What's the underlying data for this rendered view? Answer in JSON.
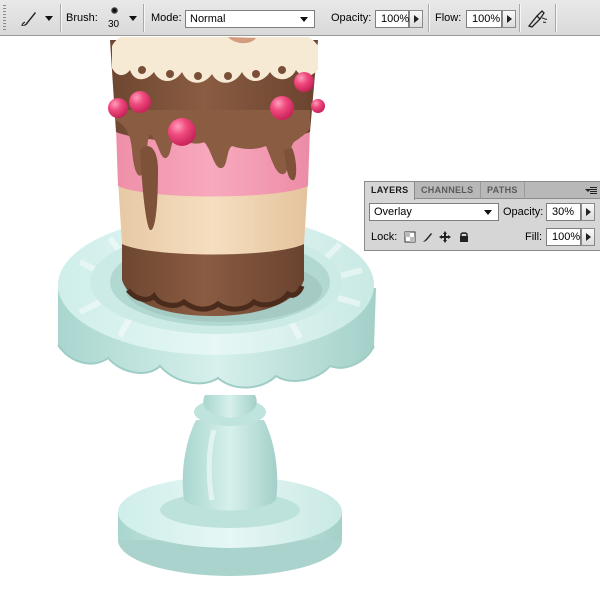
{
  "toolbar": {
    "tool_preset_icon": "brush-icon",
    "brush_label": "Brush:",
    "brush_size": "30",
    "mode_label": "Mode:",
    "mode_value": "Normal",
    "opacity_label": "Opacity:",
    "opacity_value": "100%",
    "flow_label": "Flow:",
    "flow_value": "100%",
    "airbrush_icon": "airbrush-icon"
  },
  "layers_panel": {
    "tabs": [
      {
        "label": "LAYERS",
        "active": true
      },
      {
        "label": "CHANNELS",
        "active": false
      },
      {
        "label": "PATHS",
        "active": false
      }
    ],
    "blend_mode": "Overlay",
    "opacity_label": "Opacity:",
    "opacity_value": "30%",
    "lock_label": "Lock:",
    "lock_icons": [
      "lock-transparent-pixels-icon",
      "lock-image-pixels-icon",
      "lock-position-icon",
      "lock-all-icon"
    ],
    "fill_label": "Fill:",
    "fill_value": "100%"
  },
  "colors": {
    "cake_chocolate": "#7a4f38",
    "cake_cream": "#f1d8b6",
    "cake_pink": "#f49bb2",
    "berry": "#ee3d74",
    "stand": "#bfe3de"
  }
}
